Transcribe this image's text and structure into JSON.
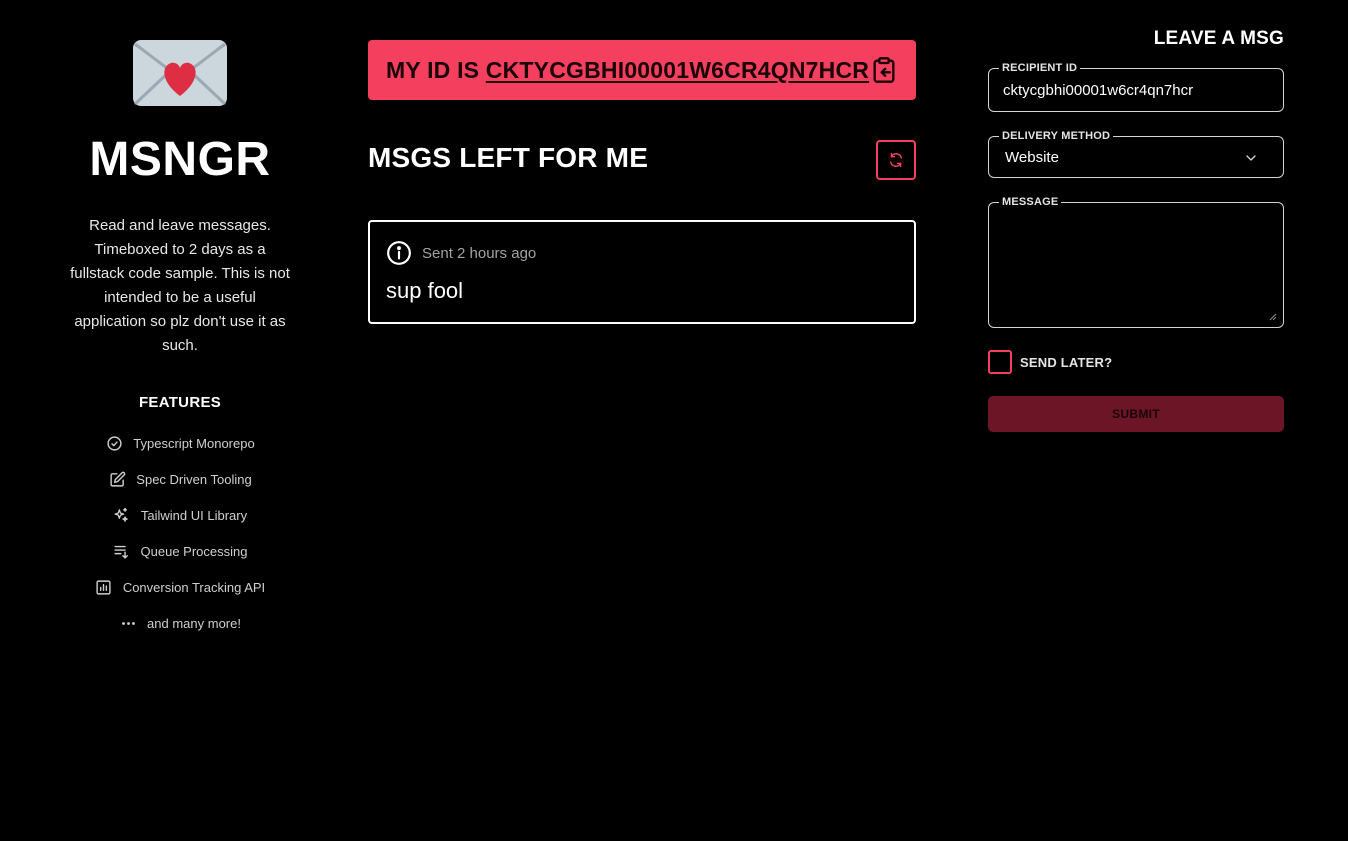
{
  "sidebar": {
    "logo_icon": "love-letter-icon",
    "title": "MSNGR",
    "description": "Read and leave messages. Timeboxed to 2 days as a fullstack code sample. This is not intended to be a useful application so plz don't use it as such.",
    "features_title": "FEATURES",
    "features": [
      {
        "label": "Typescript Monorepo",
        "icon": "check-badge-icon"
      },
      {
        "label": "Spec Driven Tooling",
        "icon": "edit-icon"
      },
      {
        "label": "Tailwind UI Library",
        "icon": "sparkles-icon"
      },
      {
        "label": "Queue Processing",
        "icon": "queue-icon"
      },
      {
        "label": "Conversion Tracking API",
        "icon": "chart-icon"
      },
      {
        "label": "and many more!",
        "icon": "more-icon"
      }
    ]
  },
  "banner": {
    "prefix": "MY ID IS ",
    "id": "CKTYCGBHI00001W6CR4QN7HCR",
    "copy_icon": "clipboard-copy-icon"
  },
  "messages": {
    "title": "MSGS LEFT FOR ME",
    "refresh_icon": "refresh-icon",
    "items": [
      {
        "meta": "Sent 2 hours ago",
        "body": "sup fool",
        "icon": "info-icon"
      }
    ]
  },
  "form": {
    "title": "LEAVE A MSG",
    "recipient_label": "RECIPIENT ID",
    "recipient_value": "cktycgbhi00001w6cr4qn7hcr",
    "delivery_label": "DELIVERY METHOD",
    "delivery_value": "Website",
    "message_label": "MESSAGE",
    "message_value": "",
    "send_later_label": "SEND LATER?",
    "send_later_checked": false,
    "submit_label": "SUBMIT"
  },
  "colors": {
    "background": "#000000",
    "accent": "#f43f5e",
    "submit_bg": "#6b1526"
  }
}
